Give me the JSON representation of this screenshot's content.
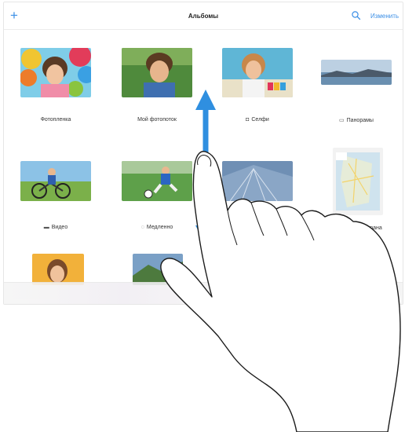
{
  "navbar": {
    "add_label": "+",
    "title": "Альбомы",
    "search_icon": "search-icon",
    "edit_label": "Изменить"
  },
  "albums": [
    {
      "label": "Фотопленка",
      "icon": ""
    },
    {
      "label": "Мой фотопоток",
      "icon": ""
    },
    {
      "label": "Селфи",
      "icon": "camera-icon"
    },
    {
      "label": "Панорамы",
      "icon": "panorama-icon"
    },
    {
      "label": "Видео",
      "icon": "video-icon"
    },
    {
      "label": "Медленно",
      "icon": "slowmo-icon"
    },
    {
      "label": "",
      "icon": ""
    },
    {
      "label": "Снимки экрана",
      "icon": "screenshot-icon"
    }
  ],
  "colors": {
    "accent": "#3b8fe6",
    "gesture_arrow": "#2f8fe0",
    "divider": "#ececec"
  },
  "gesture": {
    "type": "vertical-swipe",
    "icon": "hand-pointer-icon"
  }
}
